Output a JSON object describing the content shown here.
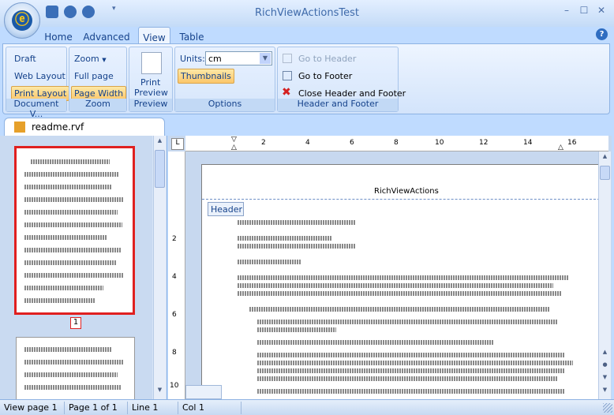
{
  "window": {
    "title": "RichViewActionsTest",
    "min": "–",
    "max": "☐",
    "close": "✕"
  },
  "tabs": [
    "Home",
    "Advanced",
    "View",
    "Table"
  ],
  "help": "?",
  "ribbon": {
    "document_views": {
      "label": "Document V...",
      "draft": "Draft",
      "web_layout": "Web Layout",
      "print_layout": "Print Layout"
    },
    "zoom": {
      "label": "Zoom",
      "zoom": "Zoom",
      "one_page": "Full page",
      "page_width": "Page Width"
    },
    "preview": {
      "label": "Preview",
      "print_preview_1": "Print",
      "print_preview_2": "Preview"
    },
    "options": {
      "label": "Options",
      "units_label": "Units:",
      "units_value": "cm",
      "thumbnails": "Thumbnails"
    },
    "header_footer": {
      "label": "Header and Footer",
      "go_header": "Go to Header",
      "go_footer": "Go to Footer",
      "close": "Close Header and Footer"
    }
  },
  "document_tab": "readme.rvf",
  "thumbnail": {
    "page_number": "1"
  },
  "editor": {
    "header_title": "RichViewActions",
    "header_tooltip": "Header",
    "ruler_marks": [
      "2",
      "4",
      "6",
      "8",
      "10",
      "12",
      "14",
      "16"
    ],
    "vruler_marks": [
      "2",
      "4",
      "6",
      "8",
      "10"
    ]
  },
  "status": [
    "View page 1",
    "Page 1 of 1",
    "Line 1",
    "Col 1"
  ]
}
